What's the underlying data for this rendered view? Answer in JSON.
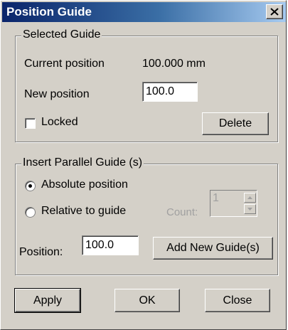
{
  "window": {
    "title": "Position Guide"
  },
  "selected_guide": {
    "legend": "Selected Guide",
    "current_position_label": "Current position",
    "current_position_value": "100.000 mm",
    "new_position_label": "New position",
    "new_position_value": "100.0",
    "locked_label": "Locked",
    "locked_checked": false,
    "delete_label": "Delete"
  },
  "insert_parallel": {
    "legend": "Insert Parallel Guide (s)",
    "absolute_label": "Absolute position",
    "relative_label": "Relative to guide",
    "selected_mode": "absolute",
    "count_label": "Count:",
    "count_value": "1",
    "position_label": "Position:",
    "position_value": "100.0",
    "add_label": "Add New Guide(s)"
  },
  "footer": {
    "apply_label": "Apply",
    "ok_label": "OK",
    "close_label": "Close"
  },
  "icons": {
    "close": "close-icon",
    "spin_up": "spin-up-icon",
    "spin_down": "spin-down-icon"
  },
  "colors": {
    "title_start": "#0a246a",
    "title_end": "#a6caf0",
    "dialog_face": "#d4d0c8"
  }
}
